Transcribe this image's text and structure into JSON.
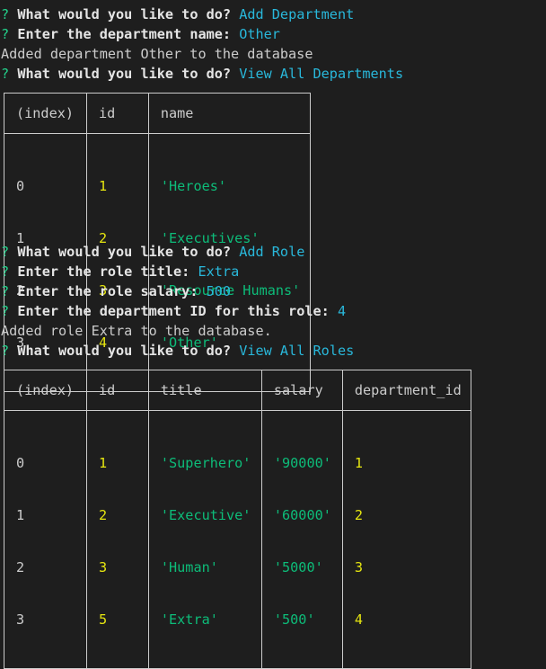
{
  "prompt_symbol": "?",
  "session": [
    {
      "type": "qa",
      "question": "What would you like to do?",
      "answer": "Add Department"
    },
    {
      "type": "qa",
      "question": "Enter the department name:",
      "answer": "Other"
    },
    {
      "type": "out",
      "text": "Added department Other to the database"
    },
    {
      "type": "qa",
      "question": "What would you like to do?",
      "answer": "View All Departments"
    },
    {
      "type": "qa",
      "question": "What would you like to do?",
      "answer": "Add Role"
    },
    {
      "type": "qa",
      "question": "Enter the role title:",
      "answer": "Extra"
    },
    {
      "type": "qa",
      "question": "Enter the role salary:",
      "answer": "500"
    },
    {
      "type": "qa",
      "question": "Enter the department ID for this role:",
      "answer": "4"
    },
    {
      "type": "out",
      "text": "Added role Extra to the database."
    },
    {
      "type": "qa",
      "question": "What would you like to do?",
      "answer": "View All Roles"
    }
  ],
  "departments_table": {
    "headers": [
      "(index)",
      "id",
      "name"
    ],
    "index": [
      "0",
      "1",
      "2",
      "3"
    ],
    "id": [
      "1",
      "2",
      "3",
      "4"
    ],
    "name": [
      "'Heroes'",
      "'Executives'",
      "'Resource Humans'",
      "'Other'"
    ]
  },
  "roles_table": {
    "headers": [
      "(index)",
      "id",
      "title",
      "salary",
      "department_id"
    ],
    "index": [
      "0",
      "1",
      "2",
      "3"
    ],
    "id": [
      "1",
      "2",
      "3",
      "5"
    ],
    "title": [
      "'Superhero'",
      "'Executive'",
      "'Human'",
      "'Extra'"
    ],
    "salary": [
      "'90000'",
      "'60000'",
      "'5000'",
      "'500'"
    ],
    "department_id": [
      "1",
      "2",
      "3",
      "4"
    ]
  },
  "colors": {
    "background": "#1e1e1e",
    "prompt_green": "#23d18b",
    "answer_cyan": "#29b8db",
    "number_yellow": "#e5e510",
    "string_green": "#0dbc79",
    "text": "#cccccc"
  }
}
